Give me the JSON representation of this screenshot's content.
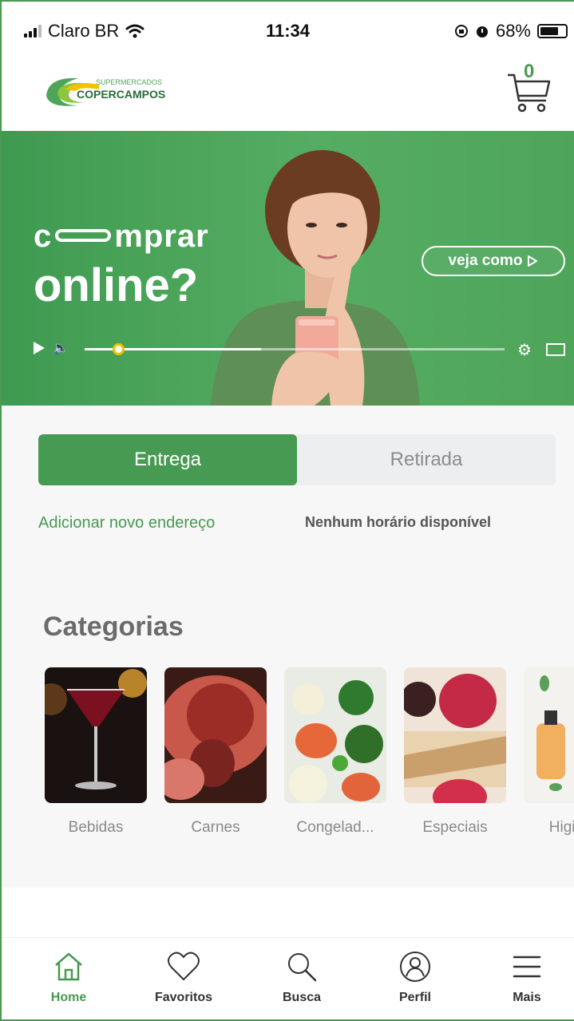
{
  "status_bar": {
    "carrier": "Claro BR",
    "time": "11:34",
    "battery": "68%"
  },
  "header": {
    "logo_top_text": "SUPERMERCADOS",
    "logo_brand_text": "COPERCAMPOS",
    "cart_count": "0"
  },
  "banner": {
    "line1_start": "c",
    "line1_end": "mprar",
    "line2": "online?",
    "cta_label": "veja como",
    "video_progress": 0.08,
    "video_buffered": 0.42
  },
  "delivery": {
    "tabs": [
      {
        "label": "Entrega",
        "active": true
      },
      {
        "label": "Retirada",
        "active": false
      }
    ],
    "add_address_link": "Adicionar novo endereço",
    "schedule_status": "Nenhum horário disponível"
  },
  "categories": {
    "title": "Categorias",
    "items": [
      {
        "label": "Bebidas",
        "icon": "drinks-image"
      },
      {
        "label": "Carnes",
        "icon": "meat-image"
      },
      {
        "label": "Congelad...",
        "icon": "frozen-image"
      },
      {
        "label": "Especiais",
        "icon": "special-image"
      },
      {
        "label": "Higiene",
        "icon": "hygiene-image"
      }
    ]
  },
  "bottom_nav": {
    "items": [
      {
        "label": "Home",
        "icon": "home-icon",
        "active": true
      },
      {
        "label": "Favoritos",
        "icon": "heart-icon",
        "active": false
      },
      {
        "label": "Busca",
        "icon": "search-icon",
        "active": false
      },
      {
        "label": "Perfil",
        "icon": "profile-icon",
        "active": false
      },
      {
        "label": "Mais",
        "icon": "menu-icon",
        "active": false
      }
    ]
  },
  "colors": {
    "brand_green": "#479a51",
    "banner_green": "#4ea55a",
    "accent_yellow": "#f2c200"
  }
}
